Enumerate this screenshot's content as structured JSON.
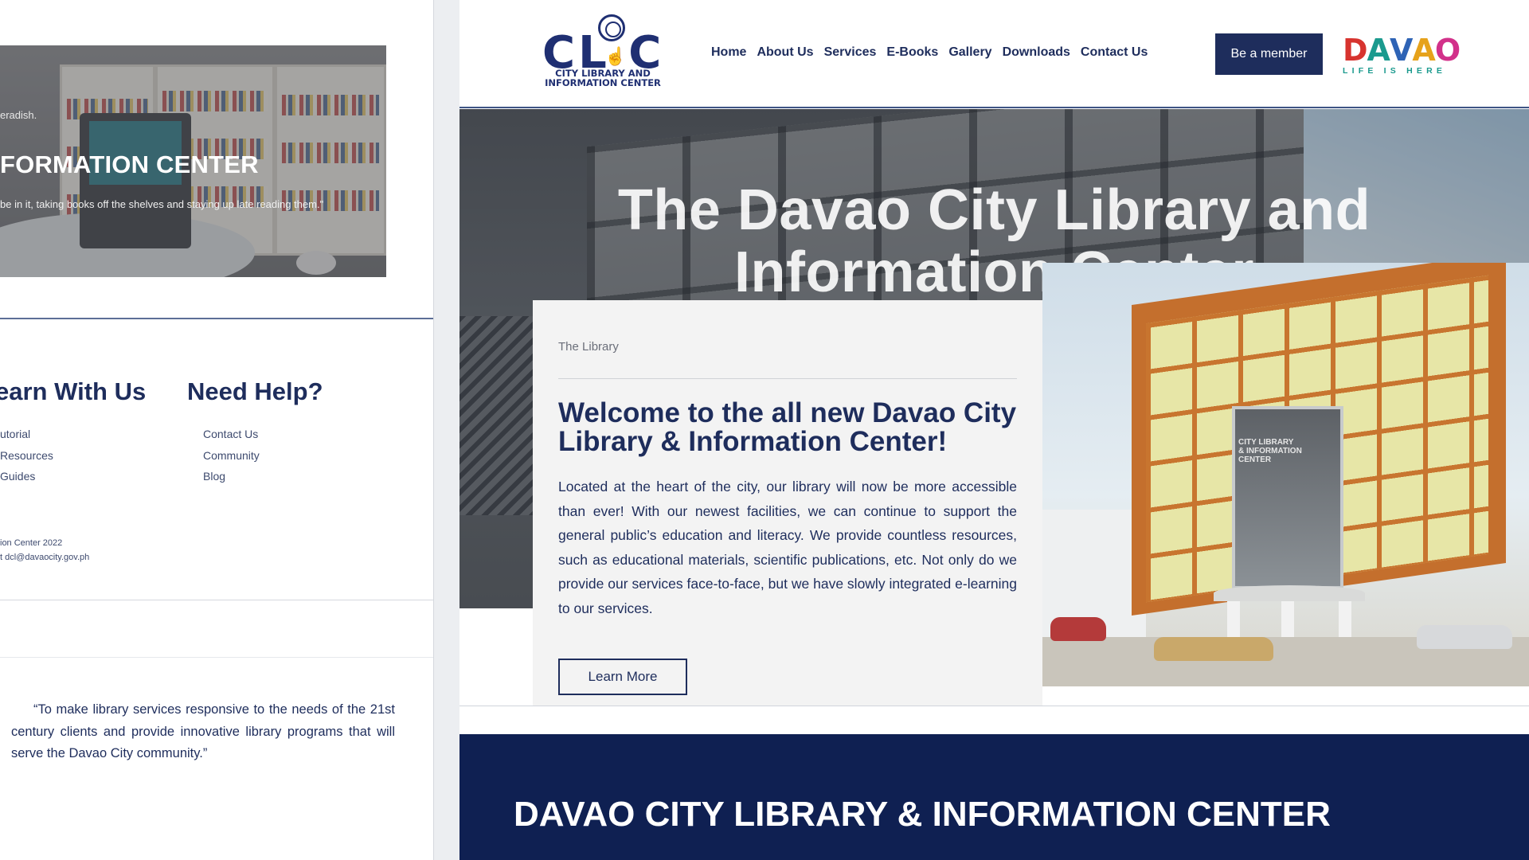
{
  "left": {
    "hero": {
      "small_text": "eradish.",
      "title": "FORMATION CENTER",
      "quote": "be in it, taking books off the shelves and staying up late reading them.\""
    },
    "footer": {
      "col1_heading": "earn With Us",
      "col1_links": [
        "utorial",
        "Resources",
        "Guides"
      ],
      "col2_heading": "Need Help?",
      "col2_links": [
        "Contact Us",
        "Community",
        "Blog"
      ],
      "copyright_line1": "ion Center 2022",
      "copyright_line2": "t dcl@davaocity.gov.ph"
    },
    "mission": "“To make library services responsive to the needs of the 21st century clients and provide innovative library programs that will serve the Davao City community.”"
  },
  "header": {
    "logo_letters": "CL C",
    "logo_sub_line1": "CITY LIBRARY AND",
    "logo_sub_line2": "INFORMATION CENTER",
    "nav": [
      "Home",
      "About Us",
      "Services",
      "E-Books",
      "Gallery",
      "Downloads",
      "Contact Us"
    ],
    "member_button": "Be a member",
    "davao_letters": [
      "D",
      "A",
      "V",
      "A",
      "O"
    ],
    "davao_tagline": "LIFE IS HERE"
  },
  "hero": {
    "title_line1": "The Davao City Library and",
    "title_line2": "Information Center"
  },
  "welcome": {
    "label": "The Library",
    "title": "Welcome to the all new Davao City Library & Information Center!",
    "body": "Located at the heart of the city, our library will now be more accessible than ever! With our newest facilities, we can continue to support the general public’s education and literacy. We provide countless resources, such as educational materials, scientific publications, etc. Not only do we provide our services face-to-face, but we have slowly integrated e-learning to our services.",
    "button": "Learn More"
  },
  "building_sign": [
    "CITY LIBRARY",
    "& INFORMATION",
    "CENTER"
  ],
  "banner": {
    "title": "DAVAO CITY LIBRARY & INFORMATION CENTER"
  },
  "colors": {
    "navy": "#1e2d5c",
    "banner_navy": "#0f2052",
    "card_bg": "#f3f3f3",
    "accent_orange": "#c46f2d"
  },
  "icons": {
    "logo_cursor": "hand-pointer-icon",
    "logo_seal": "city-seal-icon"
  }
}
